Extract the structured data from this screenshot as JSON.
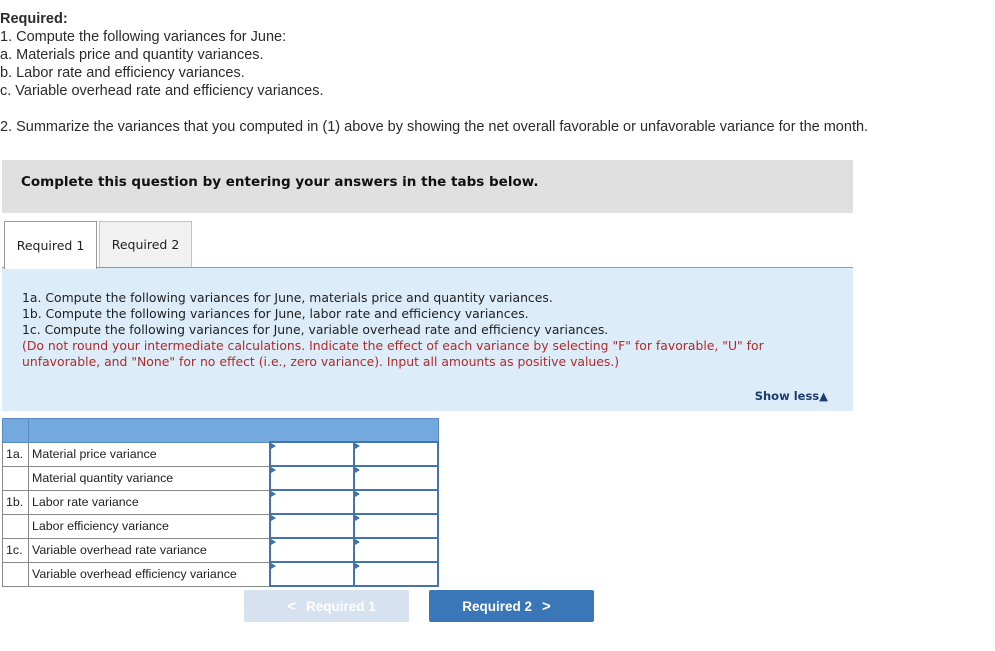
{
  "required": {
    "title": "Required:",
    "lines": [
      "1. Compute the following variances for June:",
      "a. Materials price and quantity variances.",
      "b. Labor rate and efficiency variances.",
      "c. Variable overhead rate and efficiency variances."
    ],
    "line2": "2. Summarize the variances that you computed in (1) above by showing the net overall favorable or unfavorable variance for the month."
  },
  "banner": "Complete this question by entering your answers in the tabs below.",
  "tabs": [
    {
      "label": "Required 1",
      "active": true
    },
    {
      "label": "Required 2",
      "active": false
    }
  ],
  "instructions": {
    "lines": [
      "1a. Compute the following variances for June, materials price and quantity variances.",
      "1b. Compute the following variances for June, labor rate and efficiency variances.",
      "1c. Compute the following variances for June, variable overhead rate and efficiency variances."
    ],
    "note": "(Do not round your intermediate calculations. Indicate the effect of each variance by selecting \"F\" for favorable, \"U\" for unfavorable, and \"None\" for no effect (i.e., zero variance). Input all amounts as positive values.)",
    "show_less": "Show less",
    "show_less_icon": "triangle-up-icon"
  },
  "table": {
    "rows": [
      {
        "label": "1a.",
        "name": "Material price variance",
        "amount": "",
        "effect": ""
      },
      {
        "label": "",
        "name": "Material quantity variance",
        "amount": "",
        "effect": ""
      },
      {
        "label": "1b.",
        "name": "Labor rate variance",
        "amount": "",
        "effect": ""
      },
      {
        "label": "",
        "name": "Labor efficiency variance",
        "amount": "",
        "effect": ""
      },
      {
        "label": "1c.",
        "name": "Variable overhead rate variance",
        "amount": "",
        "effect": ""
      },
      {
        "label": "",
        "name": "Variable overhead efficiency variance",
        "amount": "",
        "effect": ""
      }
    ]
  },
  "nav": {
    "prev_label": "Required 1",
    "next_label": "Required 2",
    "prev_icon": "chevron-left-icon",
    "next_icon": "chevron-right-icon"
  },
  "colors": {
    "accent": "#3a76b8",
    "panel_bg": "#dcecf8",
    "note_red": "#b22a2a",
    "table_header": "#74a9e0"
  }
}
